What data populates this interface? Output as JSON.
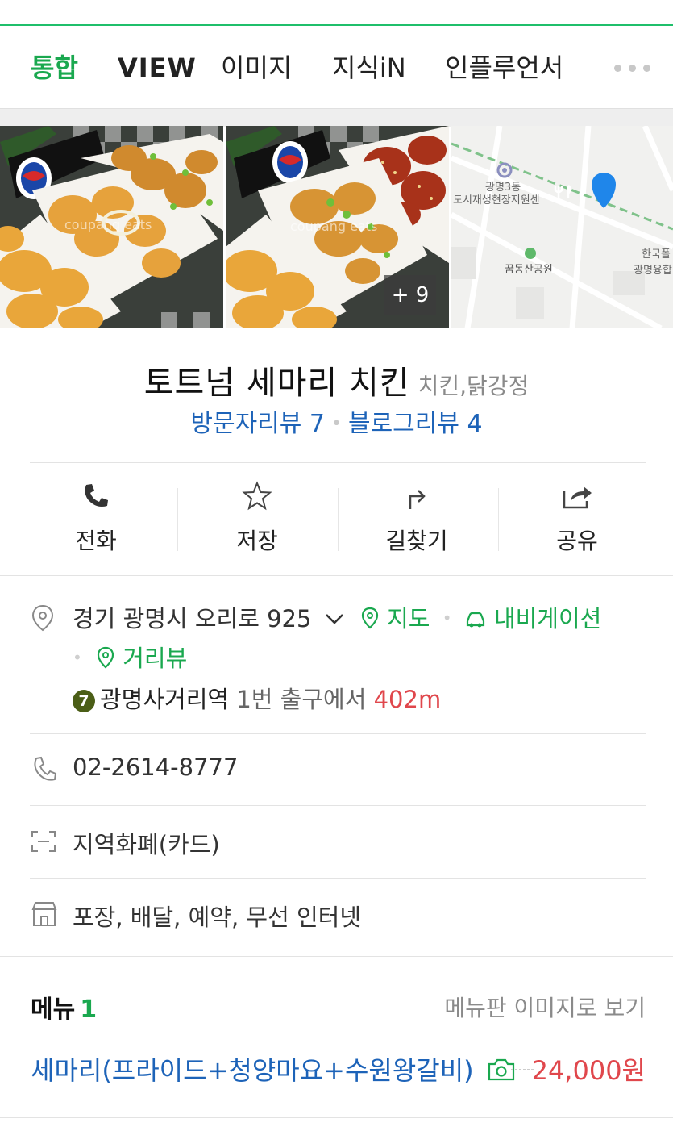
{
  "tabs": [
    "통합",
    "VIEW",
    "이미지",
    "지식iN",
    "인플루언서"
  ],
  "photos": {
    "watermark": "coupang eats",
    "more_count": "+ 9",
    "map_labels": [
      "광명3동",
      "도시재생현장지원센",
      "꿈동산공원",
      "한국폴",
      "광명융합"
    ]
  },
  "place": {
    "name": "토트넘 세마리 치킨",
    "category": "치킨,닭강정",
    "visitor_reviews": "방문자리뷰 7",
    "blog_reviews": "블로그리뷰 4"
  },
  "actions": [
    "전화",
    "저장",
    "길찾기",
    "공유"
  ],
  "info": {
    "address": "경기 광명시 오리로 925",
    "map_link": "지도",
    "navi_link": "내비게이션",
    "roadview_link": "거리뷰",
    "subway_line": "7",
    "station_name": "광명사거리역",
    "station_exit": "1번 출구에서",
    "station_distance": "402m",
    "phone": "02-2614-8777",
    "payment": "지역화폐(카드)",
    "amenities": "포장, 배달, 예약, 무선 인터넷"
  },
  "menu": {
    "heading": "메뉴",
    "count": "1",
    "view_image_link": "메뉴판 이미지로 보기",
    "items": [
      {
        "name": "세마리(프라이드+청양마요+수원왕갈비)",
        "price": "24,000원"
      }
    ]
  },
  "colors": {
    "accent_green": "#1aa84f",
    "link_blue": "#1d63b8",
    "price_red": "#e0474c"
  }
}
